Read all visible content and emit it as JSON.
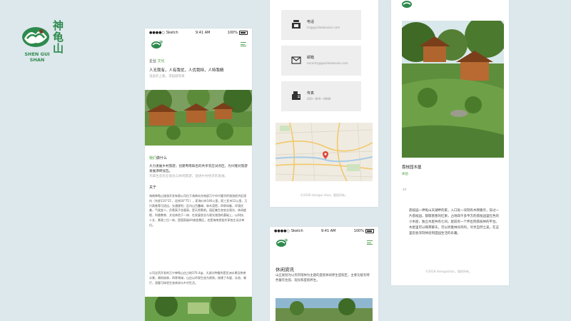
{
  "brand": {
    "name_cn": "神龟山",
    "name_en_line1": "SHEN GUI",
    "name_en_line2": "SHAN",
    "colors": {
      "green": "#2e8a4e",
      "brown": "#6b4a2f",
      "accent_green": "#4a9a3c"
    }
  },
  "phone1": {
    "status": {
      "carrier": "Sketch",
      "time": "9:41 AM",
      "battery": "100%"
    },
    "intro": {
      "heading_prefix": "企业",
      "heading_accent": "文化",
      "slogan": "人无我有，人有我优，人优我特，人特我精",
      "subtitle": "温柔的上路，求超越而来"
    },
    "section2": {
      "accent": "我们",
      "heading_rest": "做什么",
      "para1": "大力发展乡村旅游，创建粤南知名的共享农庄试点区，为兴隆对旅游发展添砖加瓦。",
      "para1_gray": "开辟生态农业观光与休闲旅游，促进乡村经济的发展。"
    },
    "about": {
      "label": "关于",
      "para": "海南神龟山旅游开发有限公司位于海南岛东南部万宁市兴隆华侨旅游经济区境内（东经110°15′，北纬18°75′），距海口市140公里，距三亚市12公里，万兴高铁等可进出，交通便利；区内山峦叠嶂，林木茂密，四季如春，环境优美，气候宜人，负氧离子含量高，是天然氧吧。园区集生态农业观光、休闲度假、科普教育、文化体验于一体，在发展农业与观光旅游的基础上，以科技、人文、景观三位一体，是国家级4A旅游景区，也是海南首批共享农庄试点单位。",
      "para2": "公司全资开发的万宁神龟山庄占地376.4亩，大部分种植的是亚洲水果及热带水果，果树成林，四季常绿，山庄以环保生态为原则，修建了木屋、泳池、餐厅，游客可体验生态休闲与乡村生活。"
    }
  },
  "phone2": {
    "contacts": [
      {
        "icon": "phone-icon",
        "label": "电话",
        "value": "hr@guoliadaoxian.com"
      },
      {
        "icon": "mail-icon",
        "label": "邮箱",
        "value": "security@guoliadaoxian.com"
      },
      {
        "icon": "fax-icon",
        "label": "传真",
        "value": "400—800—8888"
      }
    ],
    "footer": "©2018 shengui shan。版权所有。"
  },
  "phone3": {
    "status": {
      "carrier": "Sketch",
      "time": "9:41 AM",
      "battery": "100%"
    },
    "heading": "休闲资讯",
    "para": "山庄规划为以热带雨林为主题的度假休闲养生度假区，主要功能有特色餐饮住宿、观光和度假养生。"
  },
  "phone4": {
    "caption": "荔枝园木屋",
    "tag": "体验",
    "quote_mark": "“",
    "para": "荔枝园一神龟山天湖畔的家，入口处一块刻有木牌路示，穿过一片荔枝园，郁郁葱葱的红果，占地四千多平方的荔枝园里红色的小木屋，独立木屋共有七间，屋前有一个伸出到荔枝林的平台。木屋里可以喝茶聊天，可以听着林间鸟鸣，尽享自然之美，在这里您会深刻体验到田园生活的乐趣。",
    "footer": "©2018 shenguishan。版权所有。"
  }
}
